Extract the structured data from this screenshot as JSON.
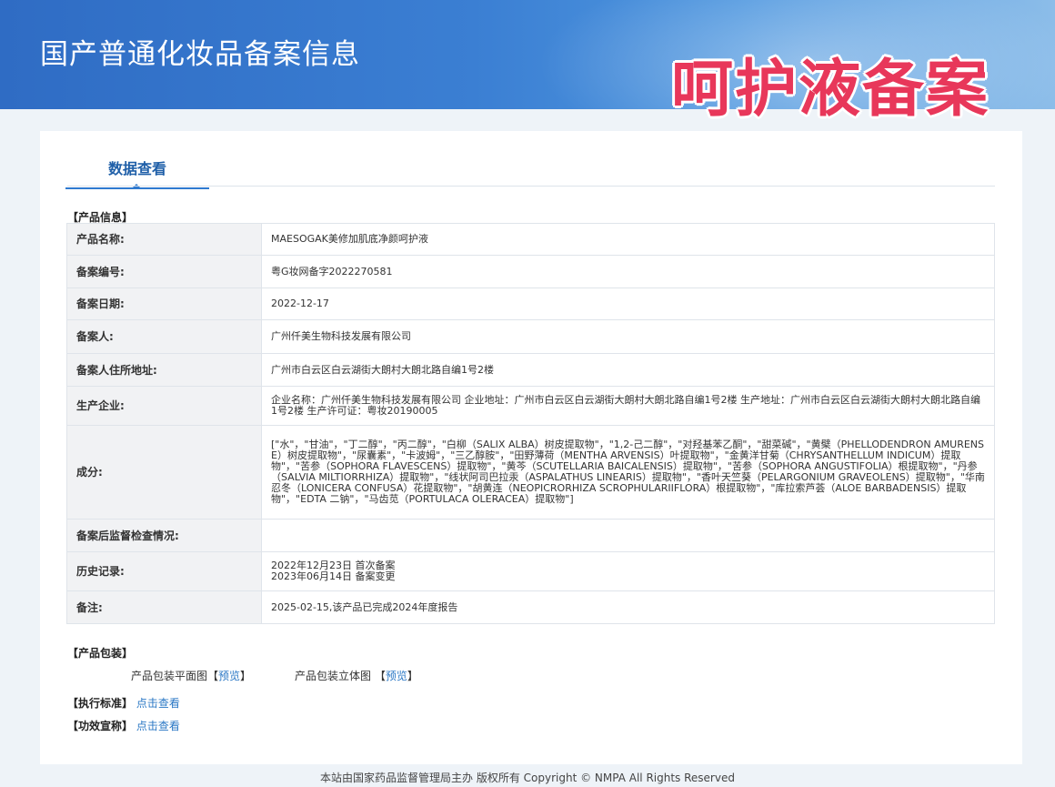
{
  "header": {
    "site_title": "国产普通化妆品备案信息",
    "stamp_text": "呵护液备案"
  },
  "tabs": [
    {
      "label": "数据查看",
      "active": true
    }
  ],
  "product_info": {
    "section_title": "【产品信息】",
    "rows": [
      {
        "label": "产品名称:",
        "value": [
          "MAESOGAK美修加肌底净颜呵护液"
        ]
      },
      {
        "label": "备案编号:",
        "value": [
          "粤G妆网备字2022270581"
        ]
      },
      {
        "label": "备案日期:",
        "value": [
          "2022-12-17"
        ]
      },
      {
        "label": "备案人:",
        "value": [
          "广州仟美生物科技发展有限公司"
        ]
      },
      {
        "label": "备案人住所地址:",
        "value": [
          "广州市白云区白云湖街大朗村大朗北路自编1号2楼"
        ]
      },
      {
        "label": "生产企业:",
        "value": [
          "企业名称：广州仟美生物科技发展有限公司 企业地址：广州市白云区白云湖街大朗村大朗北路自编1号2楼 生产地址：广州市白云区白云湖街大朗村大朗北路自编1号2楼 生产许可证：粤妆20190005"
        ]
      },
      {
        "label": "成分:",
        "value": [
          "[\"水\"，\"甘油\"，\"丁二醇\"，\"丙二醇\"，\"白柳（SALIX ALBA）树皮提取物\"，\"1,2-己二醇\"，\"对羟基苯乙酮\"，\"甜菜碱\"，\"黄檗（PHELLODENDRON AMURENSE）树皮提取物\"，\"尿囊素\"，\"卡波姆\"，\"三乙醇胺\"，\"田野薄荷（MENTHA ARVENSIS）叶提取物\"，\"金黄洋甘菊（CHRYSANTHELLUM INDICUM）提取物\"，\"苦参（SOPHORA FLAVESCENS）提取物\"，\"黄芩（SCUTELLARIA BAICALENSIS）提取物\"，\"苦参（SOPHORA ANGUSTIFOLIA）根提取物\"，\"丹参（SALVIA MILTIORRHIZA）提取物\"，\"线状阿司巴拉汞（ASPALATHUS LINEARIS）提取物\"，\"香叶天竺葵（PELARGONIUM GRAVEOLENS）提取物\"，\"华南忍冬（LONICERA CONFUSA）花提取物\"，\"胡黄连（NEOPICRORHIZA SCROPHULARIIFLORA）根提取物\"，\"库拉索芦荟（ALOE BARBADENSIS）提取物\"，\"EDTA 二钠\"，\"马齿苋（PORTULACA OLERACEA）提取物\"]"
        ]
      },
      {
        "label": "备案后监督检查情况:",
        "value": [
          ""
        ]
      },
      {
        "label": "历史记录:",
        "value": [
          "2022年12月23日 首次备案",
          "2023年06月14日 备案变更"
        ]
      },
      {
        "label": "备注:",
        "value": [
          "2025-02-15,该产品已完成2024年度报告"
        ]
      }
    ]
  },
  "packaging": {
    "section_title": "【产品包装】",
    "flat_label": "产品包装平面图",
    "solid_label": "产品包装立体图",
    "bracket_open": "【",
    "bracket_close": "】",
    "preview_link": "预览"
  },
  "standard": {
    "label": "【执行标准】",
    "link": "点击查看"
  },
  "claims": {
    "label": "【功效宣称】",
    "link": "点击查看"
  },
  "footer": {
    "text": "本站由国家药品监督管理局主办 版权所有 Copyright © NMPA All Rights Reserved"
  }
}
